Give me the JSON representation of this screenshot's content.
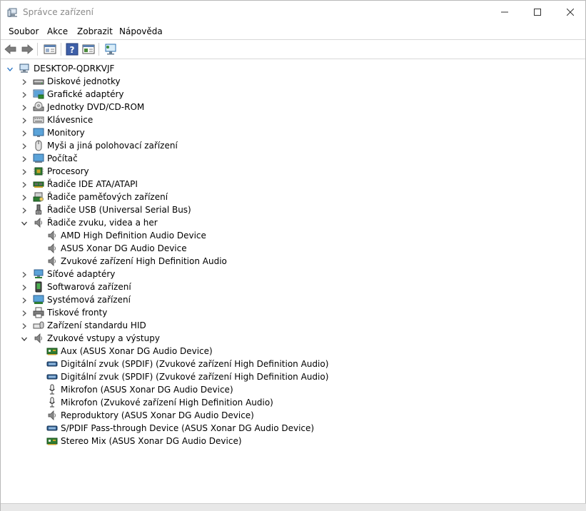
{
  "window": {
    "title": "Správce zařízení"
  },
  "menu": [
    "Soubor",
    "Akce",
    "Zobrazit",
    "Nápověda"
  ],
  "toolbar": [
    {
      "name": "back-button",
      "icon": "arrow-left-icon"
    },
    {
      "name": "forward-button",
      "icon": "arrow-right-icon"
    },
    {
      "name": "show-hide-console-tree-button",
      "icon": "console-tree-icon"
    },
    {
      "name": "help-button",
      "icon": "help-icon"
    },
    {
      "name": "properties-button",
      "icon": "properties-icon"
    },
    {
      "name": "scan-hardware-button",
      "icon": "monitor-scan-icon"
    }
  ],
  "colors": {
    "accent": "#1e6fc4",
    "title_text": "#8a8a8a",
    "speaker": "#6d6d6d"
  },
  "tree": [
    {
      "label": "DESKTOP-QDRKVJF",
      "level": 0,
      "expanded": true,
      "icon": "computer-icon"
    },
    {
      "label": "Diskové jednotky",
      "level": 1,
      "expanded": false,
      "icon": "disk-drive-icon"
    },
    {
      "label": "Grafické adaptéry",
      "level": 1,
      "expanded": false,
      "icon": "display-adapter-icon"
    },
    {
      "label": "Jednotky DVD/CD-ROM",
      "level": 1,
      "expanded": false,
      "icon": "dvd-drive-icon"
    },
    {
      "label": "Klávesnice",
      "level": 1,
      "expanded": false,
      "icon": "keyboard-icon"
    },
    {
      "label": "Monitory",
      "level": 1,
      "expanded": false,
      "icon": "monitor-icon"
    },
    {
      "label": "Myši a jiná polohovací zařízení",
      "level": 1,
      "expanded": false,
      "icon": "mouse-icon"
    },
    {
      "label": "Počítač",
      "level": 1,
      "expanded": false,
      "icon": "pc-icon"
    },
    {
      "label": "Procesory",
      "level": 1,
      "expanded": false,
      "icon": "processor-icon"
    },
    {
      "label": "Řadiče IDE ATA/ATAPI",
      "level": 1,
      "expanded": false,
      "icon": "ide-controller-icon"
    },
    {
      "label": "Řadiče paměťových zařízení",
      "level": 1,
      "expanded": false,
      "icon": "storage-controller-icon"
    },
    {
      "label": "Řadiče USB (Universal Serial Bus)",
      "level": 1,
      "expanded": false,
      "icon": "usb-icon"
    },
    {
      "label": "Řadiče zvuku, videa a her",
      "level": 1,
      "expanded": true,
      "icon": "speaker-icon"
    },
    {
      "label": "AMD High Definition Audio Device",
      "level": 2,
      "icon": "speaker-icon"
    },
    {
      "label": "ASUS Xonar DG Audio Device",
      "level": 2,
      "icon": "speaker-icon"
    },
    {
      "label": "Zvukové zařízení High Definition Audio",
      "level": 2,
      "icon": "speaker-icon"
    },
    {
      "label": "Síťové adaptéry",
      "level": 1,
      "expanded": false,
      "icon": "network-adapter-icon"
    },
    {
      "label": "Softwarová zařízení",
      "level": 1,
      "expanded": false,
      "icon": "software-device-icon"
    },
    {
      "label": "Systémová zařízení",
      "level": 1,
      "expanded": false,
      "icon": "system-device-icon"
    },
    {
      "label": "Tiskové fronty",
      "level": 1,
      "expanded": false,
      "icon": "printer-icon"
    },
    {
      "label": "Zařízení standardu HID",
      "level": 1,
      "expanded": false,
      "icon": "hid-icon"
    },
    {
      "label": "Zvukové vstupy a výstupy",
      "level": 1,
      "expanded": true,
      "icon": "speaker-icon"
    },
    {
      "label": "Aux (ASUS Xonar DG Audio Device)",
      "level": 2,
      "icon": "aux-card-icon"
    },
    {
      "label": "Digitální zvuk (SPDIF) (Zvukové zařízení High Definition Audio)",
      "level": 2,
      "icon": "spdif-icon"
    },
    {
      "label": "Digitální zvuk (SPDIF) (Zvukové zařízení High Definition Audio)",
      "level": 2,
      "icon": "spdif-icon"
    },
    {
      "label": "Mikrofon (ASUS Xonar DG Audio Device)",
      "level": 2,
      "icon": "microphone-icon"
    },
    {
      "label": "Mikrofon (Zvukové zařízení High Definition Audio)",
      "level": 2,
      "icon": "microphone-icon"
    },
    {
      "label": "Reproduktory (ASUS Xonar DG Audio Device)",
      "level": 2,
      "icon": "speaker-icon"
    },
    {
      "label": "S/PDIF Pass-through Device (ASUS Xonar DG Audio Device)",
      "level": 2,
      "icon": "spdif-icon"
    },
    {
      "label": "Stereo Mix (ASUS Xonar DG Audio Device)",
      "level": 2,
      "icon": "aux-card-icon"
    }
  ]
}
